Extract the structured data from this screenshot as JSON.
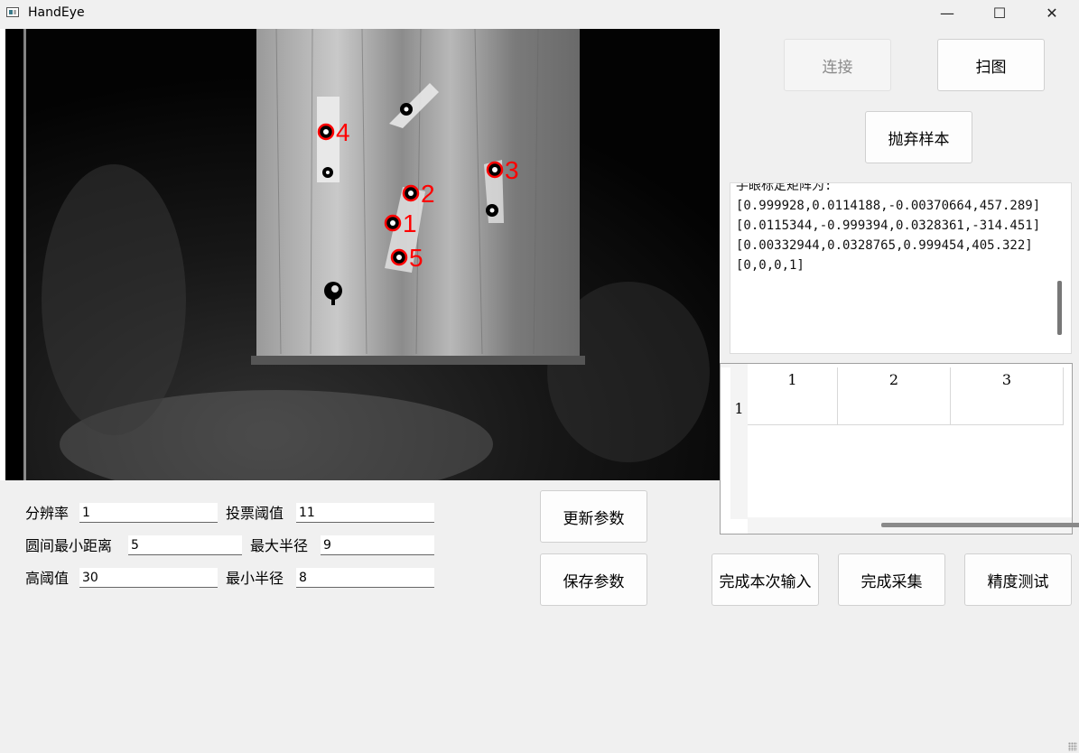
{
  "window": {
    "title": "HandEye",
    "minimize": "—",
    "maximize": "☐",
    "close": "✕"
  },
  "image": {
    "markers": [
      {
        "label": "1",
        "color": "#ff0000"
      },
      {
        "label": "2",
        "color": "#ff0000"
      },
      {
        "label": "3",
        "color": "#ff0000"
      },
      {
        "label": "4",
        "color": "#ff0000"
      },
      {
        "label": "5",
        "color": "#ff0000"
      }
    ]
  },
  "buttons": {
    "connect": "连接",
    "scan": "扫图",
    "discard": "抛弃样本",
    "update_params": "更新参数",
    "save_params": "保存参数",
    "finish_input": "完成本次输入",
    "finish_collect": "完成采集",
    "accuracy_test": "精度测试"
  },
  "log": {
    "text": "手眼标定矩阵为:\n[0.999928,0.0114188,-0.00370664,457.289]\n[0.0115344,-0.999394,0.0328361,-314.451]\n[0.00332944,0.0328765,0.999454,405.322]\n[0,0,0,1]"
  },
  "table": {
    "columns": [
      "1",
      "2",
      "3"
    ],
    "rows": [
      "1"
    ]
  },
  "params": {
    "resolution_label": "分辨率",
    "resolution_value": "1",
    "vote_label": "投票阈值",
    "vote_value": "11",
    "min_dist_label": "圆间最小距离",
    "min_dist_value": "5",
    "max_radius_label": "最大半径",
    "max_radius_value": "9",
    "high_thresh_label": "高阈值",
    "high_thresh_value": "30",
    "min_radius_label": "最小半径",
    "min_radius_value": "8"
  }
}
